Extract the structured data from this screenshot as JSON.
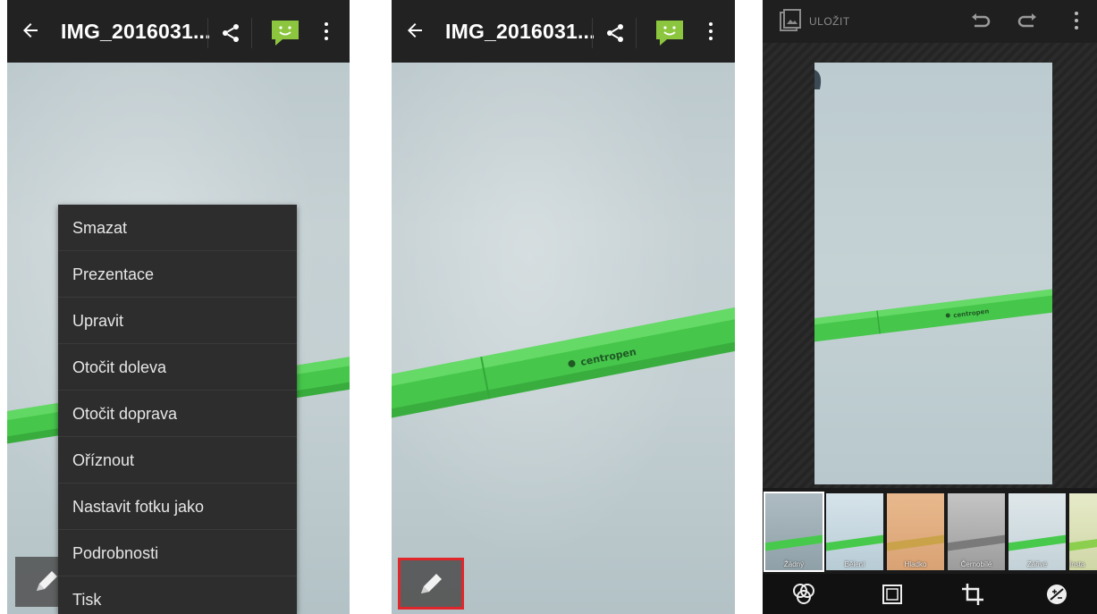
{
  "gallery": {
    "title": "IMG_2016031...",
    "icons": {
      "back": "arrow-back-icon",
      "share": "share-icon",
      "messaging": "message-smiley-icon",
      "overflow": "more-vertical-icon",
      "edit": "pencil-icon"
    },
    "pen_brand": "centropen",
    "menu_items": [
      "Smazat",
      "Prezentace",
      "Upravit",
      "Otočit doleva",
      "Otočit doprava",
      "Oříznout",
      "Nastavit fotku jako",
      "Podrobnosti",
      "Tisk"
    ]
  },
  "editor": {
    "save_label": "ULOŽIT",
    "filters": [
      "Žádný",
      "Bělení",
      "Hladko",
      "Černobílé",
      "Zářivé",
      "Insta"
    ],
    "selected_filter": 0,
    "tools": [
      "filters-icon",
      "frame-icon",
      "crop-icon",
      "adjust-icon"
    ]
  },
  "colors": {
    "appbar": "#222222",
    "highlight": "#e0262a",
    "pen": "#47c94c",
    "menu": "#2d2d2d"
  }
}
